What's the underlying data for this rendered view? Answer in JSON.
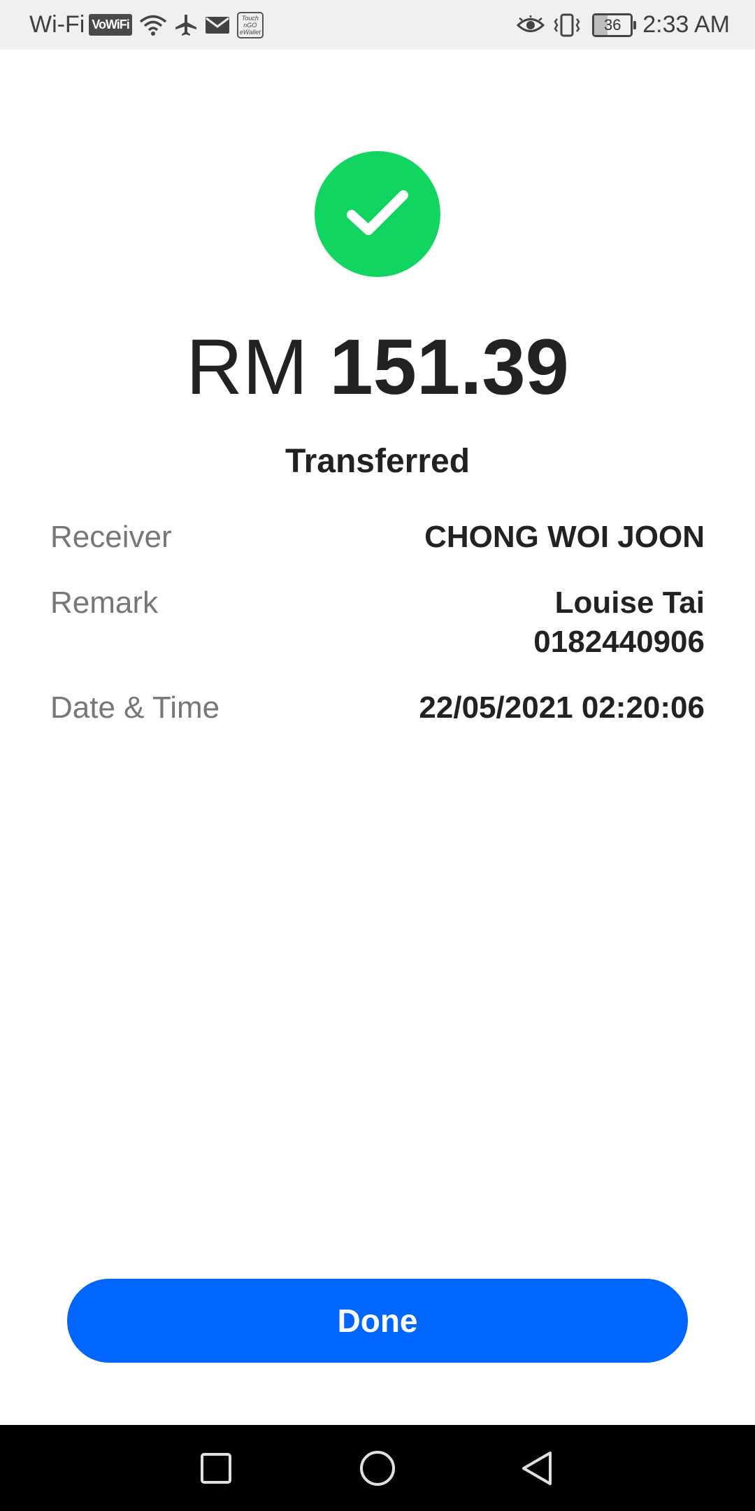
{
  "status_bar": {
    "network_label": "Wi-Fi",
    "vowifi_badge": "VoWiFi",
    "tng_badge_line1": "Touch",
    "tng_badge_line2": "nGO",
    "tng_badge_line3": "eWallet",
    "battery_level": "36",
    "time": "2:33 AM",
    "icons": [
      "wifi-icon",
      "airplane-icon",
      "mail-icon",
      "tng-ewallet-icon",
      "eye-icon",
      "vibrate-icon",
      "battery-icon"
    ]
  },
  "result": {
    "icon": "checkmark-icon",
    "icon_color": "#12d561",
    "currency": "RM",
    "amount": "151.39",
    "status": "Transferred"
  },
  "details": {
    "receiver_label": "Receiver",
    "receiver_value": "CHONG WOI JOON",
    "remark_label": "Remark",
    "remark_line1": "Louise Tai",
    "remark_line2": "0182440906",
    "datetime_label": "Date & Time",
    "datetime_value": "22/05/2021 02:20:06"
  },
  "actions": {
    "done_label": "Done",
    "done_color": "#0066ff"
  },
  "nav_bar": {
    "buttons": [
      "recents-square-icon",
      "home-circle-icon",
      "back-triangle-icon"
    ]
  }
}
